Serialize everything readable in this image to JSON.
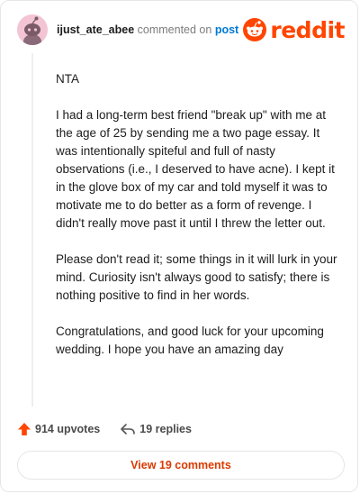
{
  "header": {
    "username": "ijust_ate_abee",
    "commented_on": "commented on",
    "post_link": "post",
    "brand_name": "reddit"
  },
  "comment": {
    "paragraphs": [
      "NTA",
      "I had a long-term best friend \"break up\" with me at the age of 25 by sending me a two page essay. It was intentionally spiteful and full of nasty observations (i.e., I deserved to have acne). I kept it in the glove box of my car and told myself it was to motivate me to do better as a form of revenge. I didn't really move past it until I threw the letter out.",
      "Please don't read it; some things in it will lurk in your mind. Curiosity isn't always good to satisfy; there is nothing positive to find in her words.",
      "Congratulations, and good luck for your upcoming wedding. I hope you have an amazing day"
    ]
  },
  "actions": {
    "upvotes": "914 upvotes",
    "replies": "19 replies",
    "view_comments": "View 19 comments"
  },
  "icons": {
    "avatar": "snoo-avatar-icon",
    "brand": "reddit-logo-icon",
    "upvote": "upvote-arrow-icon",
    "reply": "reply-arrow-icon"
  },
  "colors": {
    "brand": "#ff4500",
    "link": "#0079d3",
    "upvote": "#ff4500",
    "view_button_text": "#d93a00"
  }
}
